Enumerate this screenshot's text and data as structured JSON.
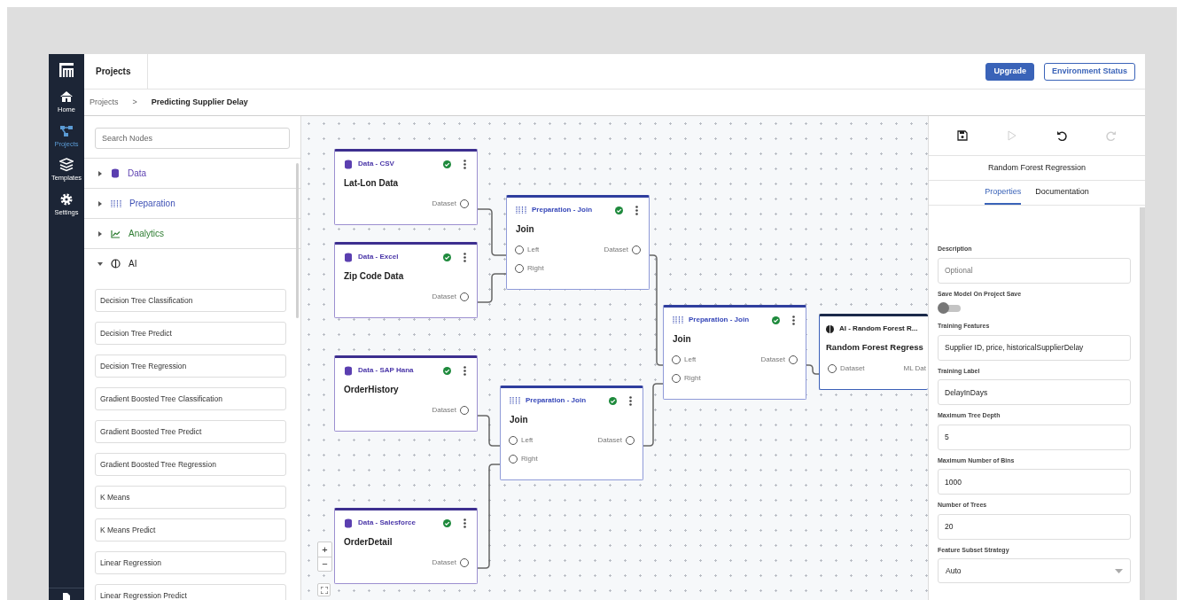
{
  "nav_rail": [
    {
      "label": "Home",
      "selected": false
    },
    {
      "label": "Projects",
      "selected": true
    },
    {
      "label": "Templates",
      "selected": false
    },
    {
      "label": "Settings",
      "selected": false
    }
  ],
  "header": {
    "tab": "Projects",
    "buttons": [
      {
        "label": "Upgrade",
        "kind": "primary"
      },
      {
        "label": "Environment Status",
        "kind": "outline"
      }
    ]
  },
  "breadcrumb": [
    "Projects",
    ">",
    "Predicting Supplier Delay"
  ],
  "node_library": {
    "search": {
      "placeholder": "Search Nodes"
    },
    "categories": [
      {
        "label": "Data",
        "kind": "data",
        "expanded": false
      },
      {
        "label": "Preparation",
        "kind": "preparation",
        "expanded": false
      },
      {
        "label": "Analytics",
        "kind": "analytics",
        "expanded": false
      },
      {
        "label": "AI",
        "kind": "ai",
        "expanded": true,
        "items": [
          "Decision Tree Classification",
          "Decision Tree Predict",
          "Decision Tree Regression",
          "Gradient Boosted Tree Classification",
          "Gradient Boosted Tree Predict",
          "Gradient Boosted Tree Regression",
          "K Means",
          "K Means Predict",
          "Linear Regression",
          "Linear Regression Predict"
        ]
      }
    ]
  },
  "canvas": {
    "nodes": [
      {
        "kind": "data",
        "category": "Data - CSV",
        "title": "Lat-Lon Data",
        "valid": true,
        "outputs": [
          "Dataset"
        ]
      },
      {
        "kind": "data",
        "category": "Data - Excel",
        "title": "Zip Code Data",
        "valid": true,
        "outputs": [
          "Dataset"
        ]
      },
      {
        "kind": "data",
        "category": "Data - SAP Hana",
        "title": "OrderHistory",
        "valid": true,
        "outputs": [
          "Dataset"
        ]
      },
      {
        "kind": "data",
        "category": "Data - Salesforce",
        "title": "OrderDetail",
        "valid": true,
        "outputs": [
          "Dataset"
        ]
      },
      {
        "kind": "preparation",
        "category": "Preparation - Join",
        "title": "Join",
        "valid": true,
        "inputs": [
          "Left",
          "Right"
        ],
        "outputs": [
          "Dataset"
        ]
      },
      {
        "kind": "preparation",
        "category": "Preparation - Join",
        "title": "Join",
        "valid": true,
        "inputs": [
          "Left",
          "Right"
        ],
        "outputs": [
          "Dataset"
        ]
      },
      {
        "kind": "preparation",
        "category": "Preparation - Join",
        "title": "Join",
        "valid": true,
        "inputs": [
          "Left",
          "Right"
        ],
        "outputs": [
          "Dataset"
        ]
      },
      {
        "kind": "ai",
        "category": "AI - Random Forest R...",
        "title": "Random Forest Regress",
        "inputs": [
          "Dataset"
        ],
        "outputs": [
          "ML Dat"
        ]
      }
    ],
    "zoom_controls": [
      "+",
      "−"
    ]
  },
  "properties_panel": {
    "toolbar": [
      {
        "kind": "save",
        "disabled": false
      },
      {
        "kind": "run",
        "disabled": true
      },
      {
        "kind": "undo",
        "disabled": false
      },
      {
        "kind": "redo",
        "disabled": true
      }
    ],
    "title": "Random Forest Regression",
    "tabs": [
      {
        "label": "Properties",
        "selected": true
      },
      {
        "label": "Documentation",
        "selected": false
      }
    ],
    "fields": [
      {
        "kind": "text",
        "label": "Description",
        "placeholder": "Optional"
      },
      {
        "kind": "toggle",
        "label": "Save Model On Project Save",
        "on": false
      },
      {
        "kind": "text",
        "label": "Training Features",
        "value": "Supplier ID, price, historicalSupplierDelay"
      },
      {
        "kind": "text",
        "label": "Training Label",
        "value": "DelayInDays"
      },
      {
        "kind": "text",
        "label": "Maximum Tree Depth",
        "value": "5"
      },
      {
        "kind": "text",
        "label": "Maximum Number of Bins",
        "value": "1000"
      },
      {
        "kind": "text",
        "label": "Number of Trees",
        "value": "20"
      },
      {
        "kind": "select",
        "label": "Feature Subset Strategy",
        "value": "Auto"
      }
    ]
  }
}
